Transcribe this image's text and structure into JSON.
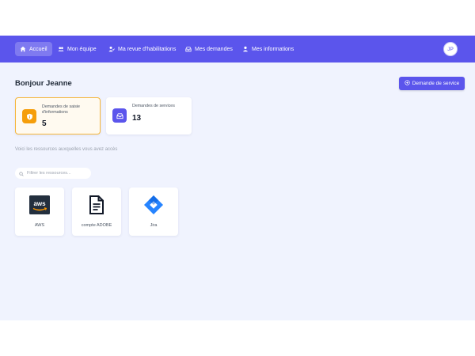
{
  "nav": {
    "items": [
      {
        "label": "Accueil",
        "icon": "home-icon",
        "active": true
      },
      {
        "label": "Mon équipe",
        "icon": "team-icon",
        "active": false
      },
      {
        "label": "Ma revue d'habilitations",
        "icon": "user-check-icon",
        "active": false
      },
      {
        "label": "Mes demandes",
        "icon": "inbox-icon",
        "active": false
      },
      {
        "label": "Mes informations",
        "icon": "user-icon",
        "active": false
      }
    ],
    "avatar_initials": "JP"
  },
  "main": {
    "greeting": "Bonjour Jeanne",
    "cta_label": "Demande de service",
    "stats": [
      {
        "label": "Demandes de saisie d'informations",
        "value": "5",
        "icon": "info-shield-icon",
        "color": "#f59e0b"
      },
      {
        "label": "Demandes de services",
        "value": "13",
        "icon": "inbox-icon",
        "color": "#5b55ec"
      }
    ],
    "hint": "Voici les ressources auxquelles vous avez accès",
    "search_placeholder": "Filtrer les ressources...",
    "resources": [
      {
        "label": "AWS",
        "icon": "aws-logo"
      },
      {
        "label": "compte ADOBE",
        "icon": "document-icon"
      },
      {
        "label": "Jira",
        "icon": "jira-logo"
      }
    ]
  },
  "colors": {
    "accent": "#5b55ec",
    "warning": "#f59e0b",
    "background": "#f0f3fe"
  }
}
